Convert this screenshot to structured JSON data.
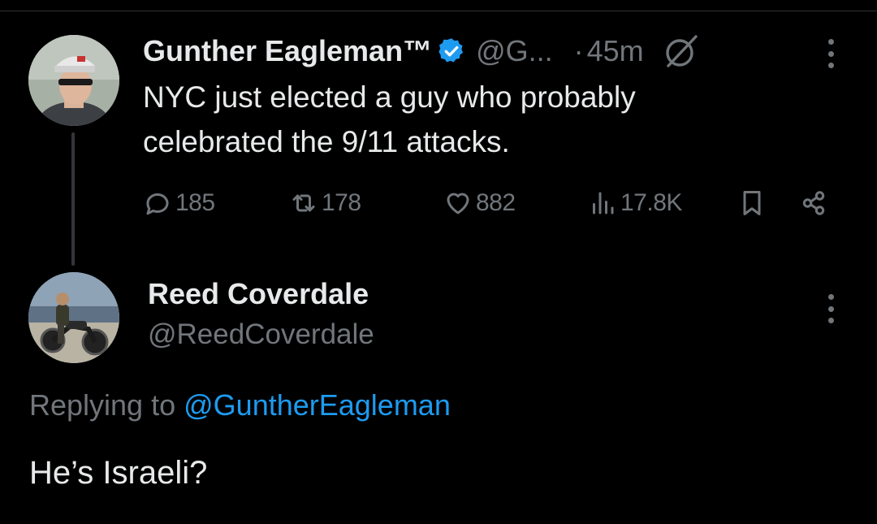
{
  "parent_tweet": {
    "display_name": "Gunther Eagleman™",
    "handle": "@G...",
    "dot": "·",
    "time": "45m",
    "text_line1": "NYC just elected a guy who probably",
    "text_line2": "celebrated the 9/11 attacks.",
    "replies": "185",
    "reposts": "178",
    "likes": "882",
    "views": "17.8K",
    "icons": [
      "verified-badge-icon",
      "grok-icon",
      "more-icon",
      "reply-icon",
      "repost-icon",
      "like-icon",
      "views-icon",
      "bookmark-icon",
      "share-icon"
    ]
  },
  "reply_tweet": {
    "display_name": "Reed Coverdale",
    "handle": "@ReedCoverdale",
    "replying_prefix": "Replying to",
    "replying_to": "@GuntherEagleman",
    "text": "He’s Israeli?"
  },
  "colors": {
    "background": "#000000",
    "primary_text": "#e7e9ea",
    "secondary_text": "#71767b",
    "accent": "#1d9bf0"
  }
}
